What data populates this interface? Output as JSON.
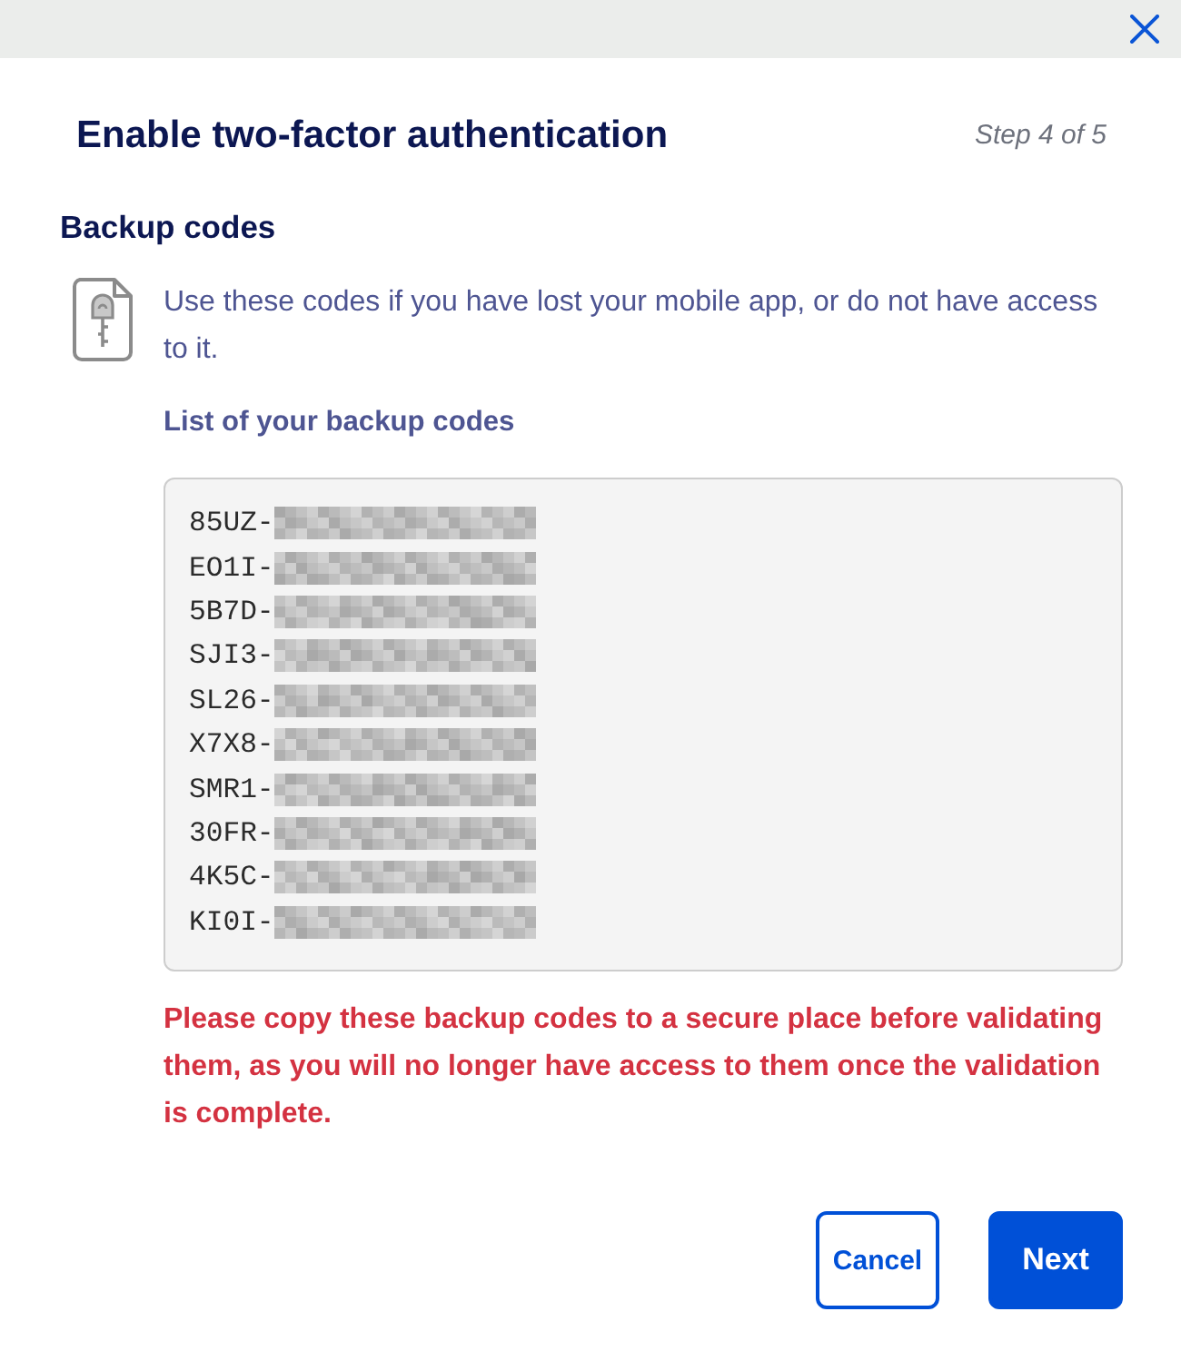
{
  "header": {
    "title": "Enable two-factor authentication",
    "step": "Step 4 of 5"
  },
  "section": {
    "heading": "Backup codes",
    "description": "Use these codes if you have lost your mobile app, or do not have access to it.",
    "list_label": "List of your backup codes",
    "codes": [
      {
        "visible": "85UZ-",
        "redacted": true
      },
      {
        "visible": "EO1I-",
        "redacted": true
      },
      {
        "visible": "5B7D-",
        "redacted": true
      },
      {
        "visible": "SJI3-",
        "redacted": true
      },
      {
        "visible": "SL26-",
        "redacted": true
      },
      {
        "visible": "X7X8-",
        "redacted": true
      },
      {
        "visible": "SMR1-",
        "redacted": true
      },
      {
        "visible": "30FR-",
        "redacted": true
      },
      {
        "visible": "4K5C-",
        "redacted": true
      },
      {
        "visible": "KI0I-",
        "redacted": true
      }
    ],
    "warning": "Please copy these backup codes to a secure place before validating them, as you will no longer have access to them once the validation is complete."
  },
  "buttons": [
    {
      "label": "Cancel",
      "kind": "secondary"
    },
    {
      "label": "Next",
      "kind": "primary"
    }
  ]
}
